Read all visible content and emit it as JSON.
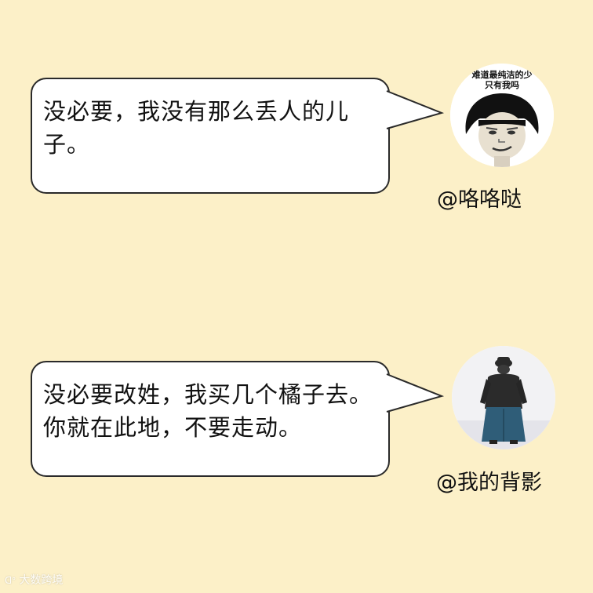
{
  "messages": [
    {
      "text": "没必要，我没有那么丢人的儿子。",
      "username": "@咯咯哒",
      "avatar": {
        "icon": "meme-face-icon",
        "caption_line1": "难道最纯洁的少",
        "caption_line2": "只有我吗"
      }
    },
    {
      "text": "没必要改姓，我买几个橘子去。你就在此地，不要走动。",
      "username": "@我的背影",
      "avatar": {
        "icon": "man-back-view-icon"
      }
    }
  ],
  "watermark": "大数跨境",
  "colors": {
    "background": "#fcf0c8",
    "bubble": "#ffffff",
    "border": "#2a2a2a"
  }
}
